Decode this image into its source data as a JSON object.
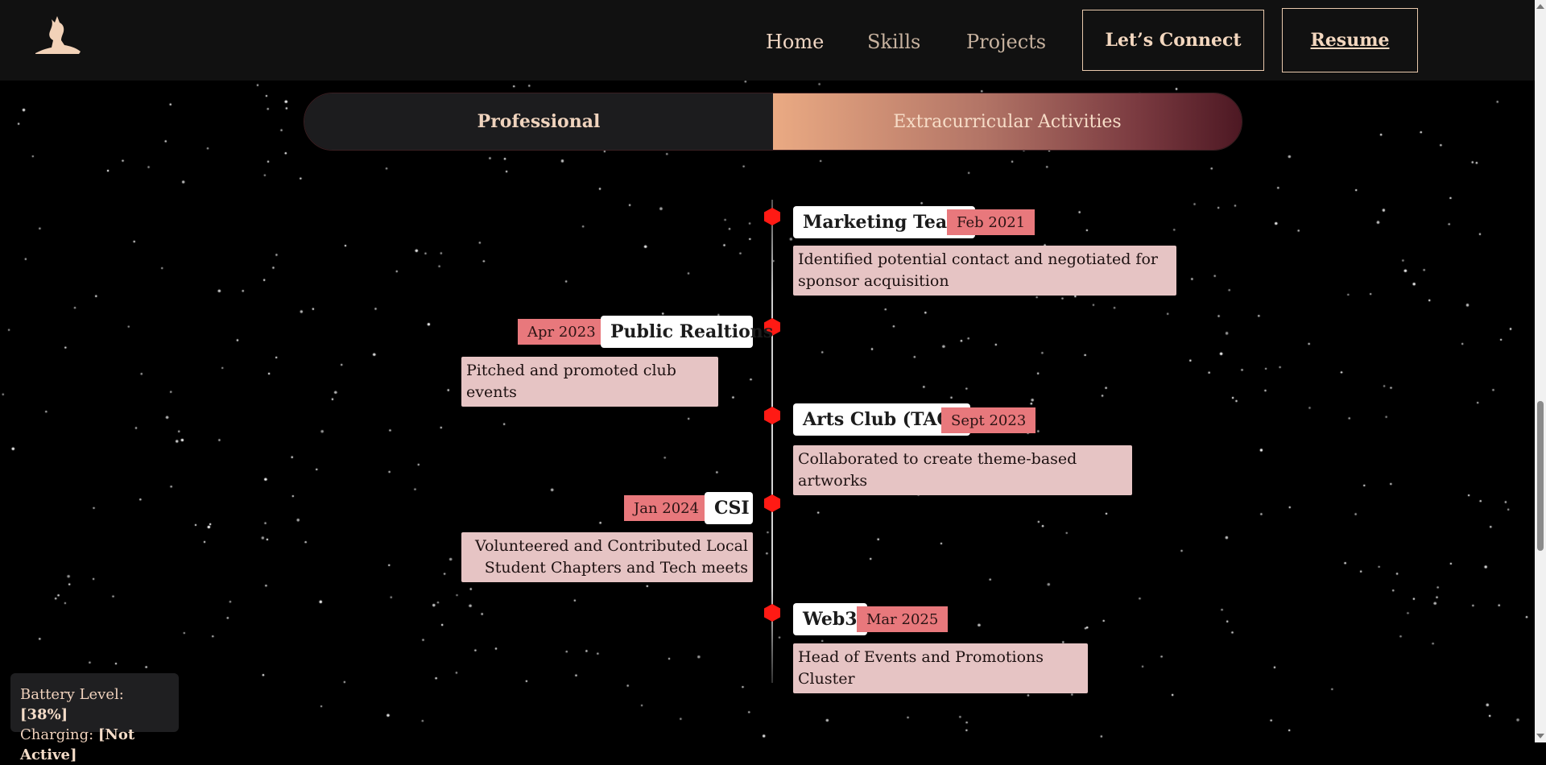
{
  "header": {
    "logo_icon": "wolf-logo-icon",
    "nav": [
      {
        "label": "Home",
        "active": true
      },
      {
        "label": "Skills",
        "active": false
      },
      {
        "label": "Projects",
        "active": false
      }
    ],
    "connect_label": "Let’s Connect",
    "resume_label": "Resume"
  },
  "tabs": {
    "professional": "Professional",
    "extracurricular": "Extracurricular Activities",
    "active": "extracurricular"
  },
  "timeline": [
    {
      "title": "Marketing Team",
      "date": "Feb 2021",
      "desc": "Identified potential contact and negotiated for sponsor acquisition",
      "side": "right"
    },
    {
      "title": "Public Realtions",
      "date": "Apr 2023",
      "desc": "Pitched and promoted club events",
      "side": "left"
    },
    {
      "title": "Arts Club (TAG)",
      "date": "Sept 2023",
      "desc": "Collaborated to create theme-based artworks",
      "side": "right"
    },
    {
      "title": "CSI",
      "date": "Jan 2024",
      "desc": "Volunteered and Contributed Local Student Chapters and Tech meets",
      "side": "left"
    },
    {
      "title": "Web3",
      "date": "Mar 2025",
      "desc": "Head of Events and Promotions Cluster",
      "side": "right"
    }
  ],
  "battery": {
    "level_label": "Battery Level:",
    "level_value": "[38%]",
    "charging_label": "Charging:",
    "charging_value": "[Not Active]"
  },
  "colors": {
    "accent": "#e9c9ad",
    "dot": "#ff1a14",
    "date_bg": "#e8787c",
    "desc_bg": "#e6c4c4"
  }
}
